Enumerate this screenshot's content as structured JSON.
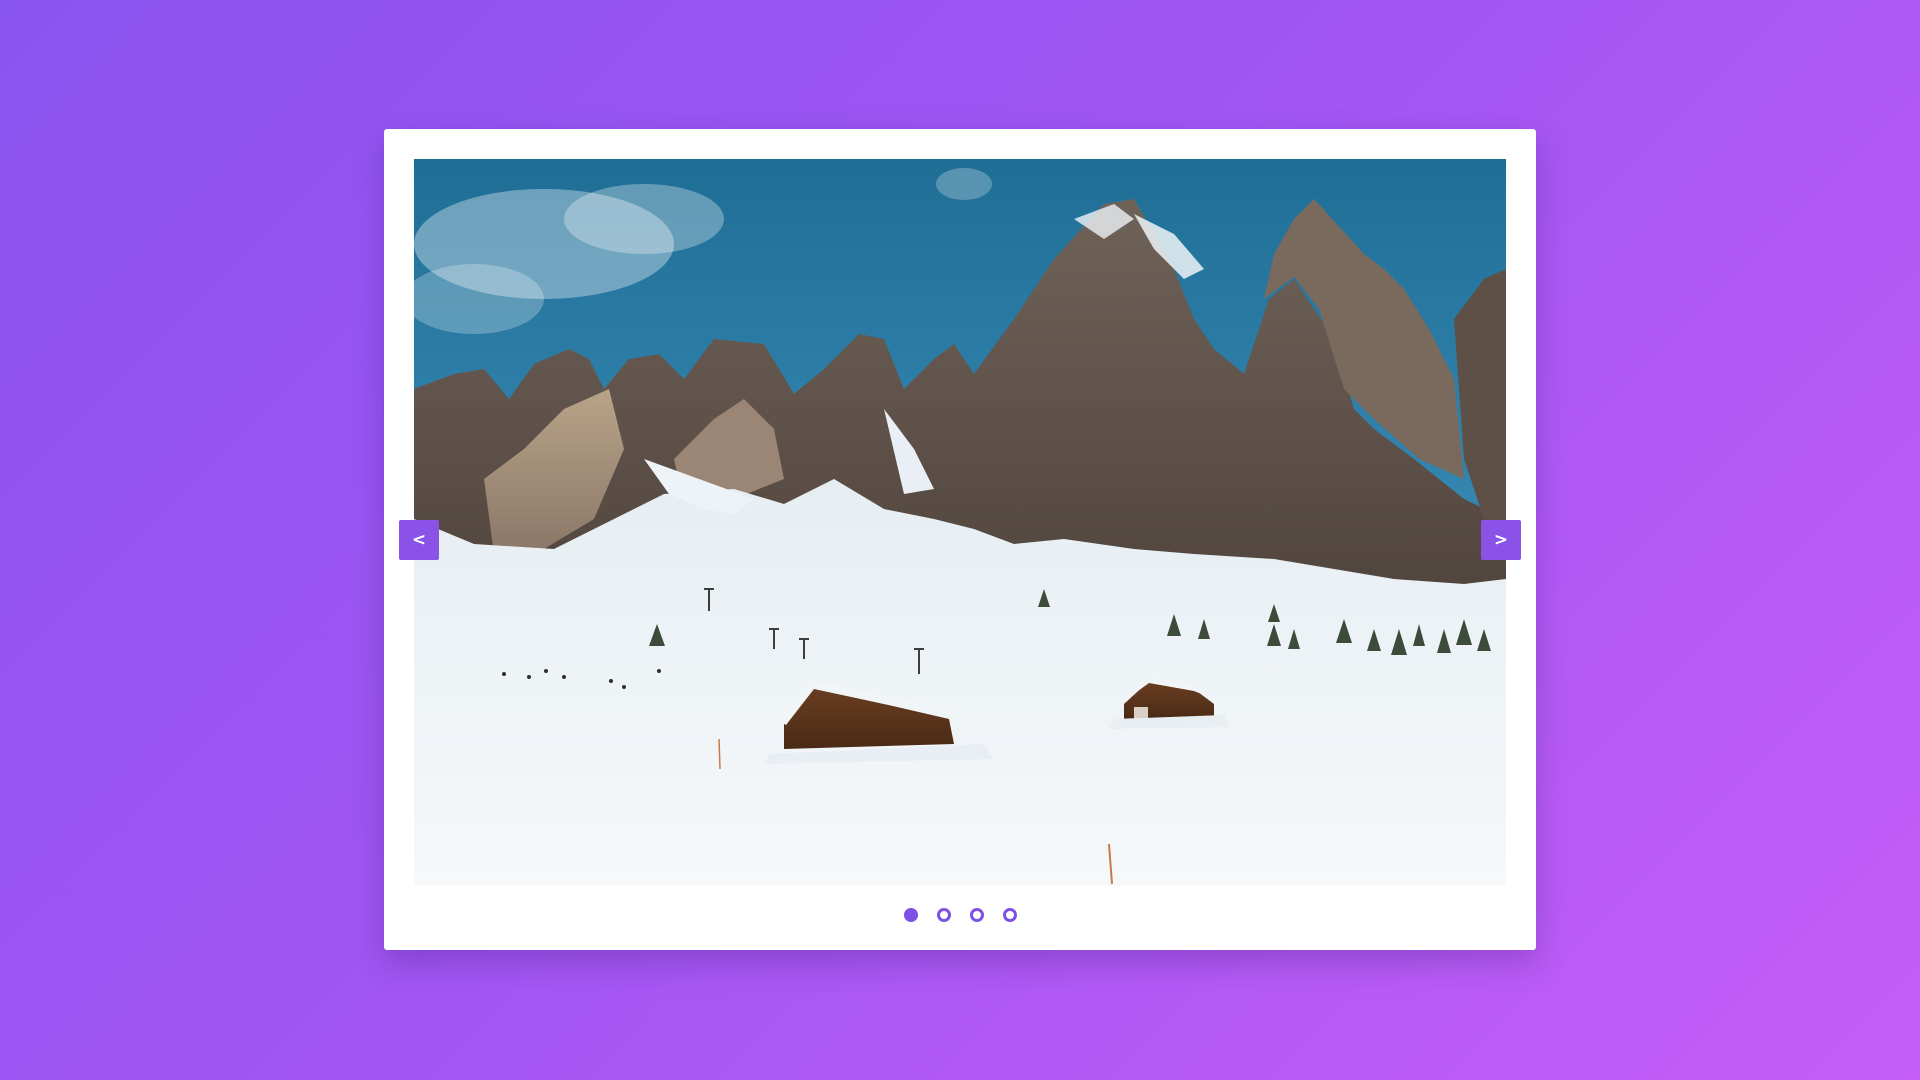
{
  "carousel": {
    "prev_label": "<",
    "next_label": ">",
    "slide_count": 4,
    "active_index": 0,
    "colors": {
      "accent": "#8b52e8",
      "card": "#ffffff",
      "background_start": "#8a54f0",
      "background_end": "#c55ef8"
    },
    "current_slide": {
      "image_icon": "snowy-mountain-landscape-image"
    }
  }
}
